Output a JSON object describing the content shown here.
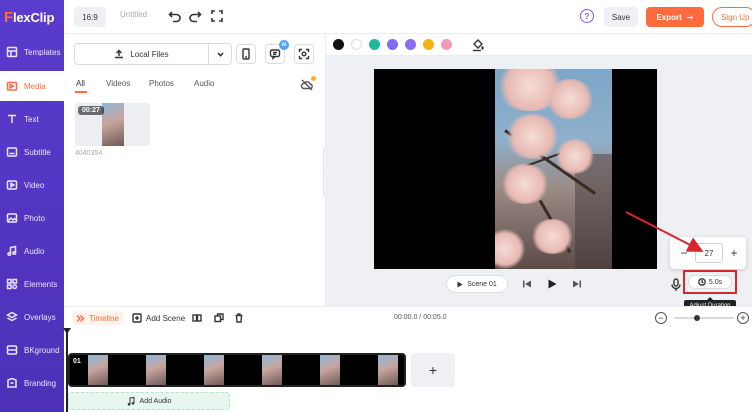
{
  "app": {
    "logo_text": "FlexClip",
    "logo_letter": "F",
    "logo_rest": "lexClip"
  },
  "topbar": {
    "ratio_label": "16:9",
    "title_placeholder": "Untitled",
    "save_label": "Save",
    "export_label": "Export",
    "signup_label": "Sign Up"
  },
  "sidebar": {
    "items": [
      {
        "label": "Templates",
        "icon": "templates-icon"
      },
      {
        "label": "Media",
        "icon": "media-icon",
        "active": true
      },
      {
        "label": "Text",
        "icon": "text-icon"
      },
      {
        "label": "Subtitle",
        "icon": "subtitle-icon"
      },
      {
        "label": "Video",
        "icon": "video-icon"
      },
      {
        "label": "Photo",
        "icon": "photo-icon"
      },
      {
        "label": "Audio",
        "icon": "audio-icon"
      },
      {
        "label": "Elements",
        "icon": "elements-icon"
      },
      {
        "label": "Overlays",
        "icon": "overlays-icon"
      },
      {
        "label": "BKground",
        "icon": "background-icon"
      },
      {
        "label": "Branding",
        "icon": "branding-icon"
      }
    ]
  },
  "media": {
    "local_files_label": "Local Files",
    "ai_badge": "AI",
    "tabs": [
      "All",
      "Videos",
      "Photos",
      "Audio"
    ],
    "active_tab": "All",
    "item": {
      "duration": "00:27",
      "name": "4040354"
    }
  },
  "canvas": {
    "colors": [
      "#111111",
      "#ffffff",
      "#1fb89b",
      "#7b6cf0",
      "#8a6cf0",
      "#f5b315",
      "#f19ab9"
    ],
    "scene_label": "Scene 01"
  },
  "duration_popover": {
    "minus_label": "−",
    "value": "27",
    "plus_label": "+",
    "button_label": "5.0s",
    "tooltip": "Adjust Duration"
  },
  "timeline": {
    "timeline_label": "Timeline",
    "add_scene_label": "Add Scene",
    "time_display": "00:00.0 / 00:05.0",
    "zoom_minus": "−",
    "zoom_plus": "+",
    "zoom_level": 0.33,
    "clip_label": "01",
    "add_clip_label": "+",
    "add_audio_label": "Add Audio"
  },
  "accent": "#ff6b3d",
  "sidebar_color": "#5a3ccd",
  "highlight_color": "#d7262c"
}
